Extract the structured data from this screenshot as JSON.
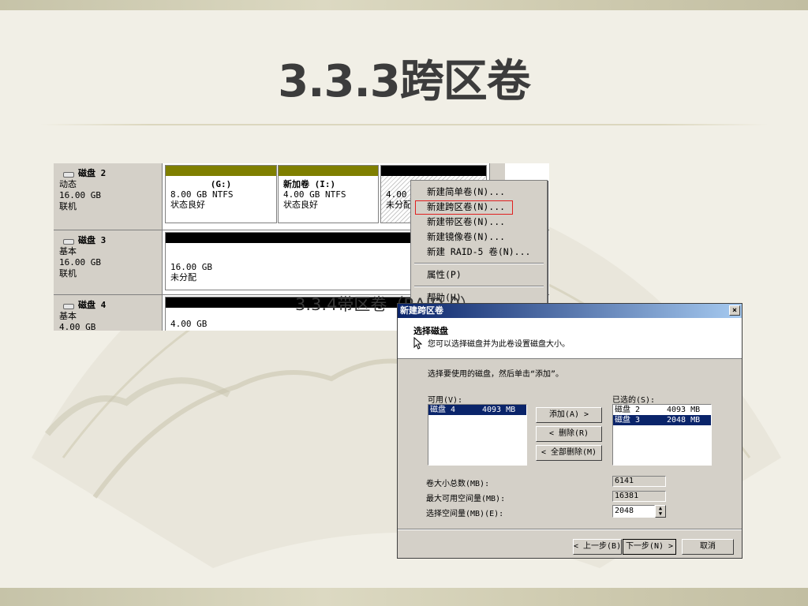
{
  "slide": {
    "title": "3.3.3跨区卷",
    "overlap_text": "3.3.4带区卷（RAID-0）"
  },
  "disk_mgmt": {
    "disks": [
      {
        "name": "磁盘 2",
        "type": "动态",
        "size": "16.00 GB",
        "status": "联机",
        "volumes": [
          {
            "name": "(G:)",
            "size": "8.00 GB NTFS",
            "state": "状态良好"
          },
          {
            "name": "新加卷  (I:)",
            "size": "4.00 GB NTFS",
            "state": "状态良好"
          },
          {
            "name": "",
            "size": "4.00",
            "state": "未分配"
          }
        ]
      },
      {
        "name": "磁盘 3",
        "type": "基本",
        "size": "16.00 GB",
        "status": "联机",
        "volumes": [
          {
            "name": "",
            "size": "16.00 GB",
            "state": "未分配"
          }
        ]
      },
      {
        "name": "磁盘 4",
        "type": "基本",
        "size": "4.00 GB",
        "status": "",
        "volumes": [
          {
            "name": "",
            "size": "4.00 GB",
            "state": ""
          }
        ]
      }
    ]
  },
  "context_menu": {
    "items": [
      "新建简单卷(N)...",
      "新建跨区卷(N)...",
      "新建带区卷(N)...",
      "新建镜像卷(N)...",
      "新建 RAID-5 卷(N)...",
      "属性(P)",
      "帮助(H)"
    ]
  },
  "wizard": {
    "title": "新建跨区卷",
    "close": "×",
    "header_title": "选择磁盘",
    "header_subtitle": "您可以选择磁盘并为此卷设置磁盘大小。",
    "instruction": "选择要使用的磁盘，然后单击“添加”。",
    "available_label": "可用(V):",
    "available": [
      {
        "disk": "磁盘 4",
        "size": "4093 MB"
      }
    ],
    "selected_label": "已选的(S):",
    "selected": [
      {
        "disk": "磁盘 2",
        "size": "4093 MB"
      },
      {
        "disk": "磁盘 3",
        "size": "2048 MB"
      }
    ],
    "add_button": "添加(A) >",
    "remove_button": "< 删除(R)",
    "remove_all_button": "< 全部删除(M)",
    "total_size_label": "卷大小总数(MB):",
    "total_size_value": "6141",
    "max_space_label": "最大可用空间量(MB):",
    "max_space_value": "16381",
    "select_space_label": "选择空间量(MB)(E):",
    "select_space_value": "2048",
    "back_button": "< 上一步(B)",
    "next_button": "下一步(N) >",
    "cancel_button": "取消"
  },
  "colors": {
    "dynamic_bar": "#7f7f00",
    "unallocated_bar": "#000000",
    "selection": "#0a246a",
    "highlight_box": "#e02020"
  }
}
